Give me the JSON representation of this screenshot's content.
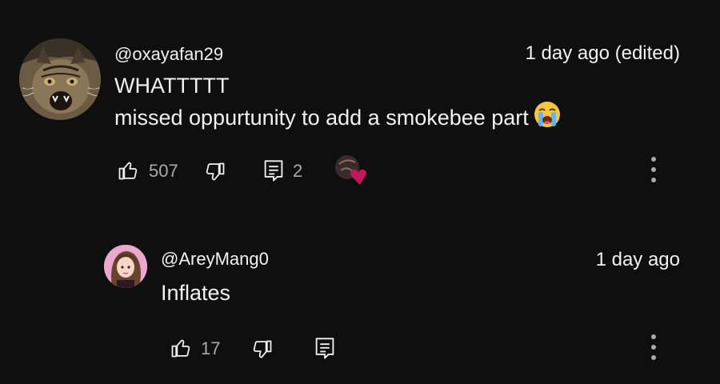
{
  "comment": {
    "username": "@oxayafan29",
    "timestamp": "1 day ago (edited)",
    "text_line1": "WHATTTTT",
    "text_line2": "missed oppurtunity to add a smokebee part",
    "emoji": "loudly-crying-face",
    "like_count": "507",
    "reply_count": "2",
    "creator_heart": true
  },
  "reply": {
    "username": "@AreyMang0",
    "timestamp": "1 day ago",
    "text": "Inflates",
    "like_count": "17"
  },
  "colors": {
    "background": "#0f0f0f",
    "text_primary": "#f1f1f1",
    "text_secondary": "#aaaaaa",
    "heart": "#c2185b"
  }
}
